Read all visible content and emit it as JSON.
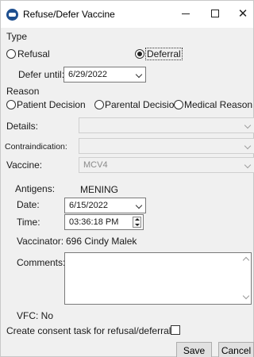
{
  "window": {
    "title": "Refuse/Defer Vaccine"
  },
  "type_section": {
    "label": "Type",
    "refusal_label": "Refusal",
    "deferral_label": "Deferral",
    "selected": "Deferral"
  },
  "defer_until": {
    "label": "Defer until:",
    "value": "6/29/2022"
  },
  "reason_section": {
    "label": "Reason",
    "options": [
      "Patient Decision",
      "Parental Decision",
      "Medical Reason"
    ]
  },
  "details": {
    "label": "Details:",
    "value": ""
  },
  "contraindication": {
    "label": "Contraindication:",
    "value": ""
  },
  "vaccine": {
    "label": "Vaccine:",
    "value": "MCV4"
  },
  "antigens": {
    "label": "Antigens:",
    "value": "MENING"
  },
  "date": {
    "label": "Date:",
    "value": "6/15/2022"
  },
  "time": {
    "label": "Time:",
    "value": "03:36:18 PM"
  },
  "vaccinator": {
    "label": "Vaccinator:",
    "value": "696 Cindy Malek"
  },
  "comments": {
    "label": "Comments:",
    "value": ""
  },
  "vfc": {
    "text": "VFC: No"
  },
  "consent": {
    "label": "Create consent task for refusal/deferral",
    "checked": false
  },
  "buttons": {
    "save": "Save",
    "cancel": "Cancel"
  }
}
